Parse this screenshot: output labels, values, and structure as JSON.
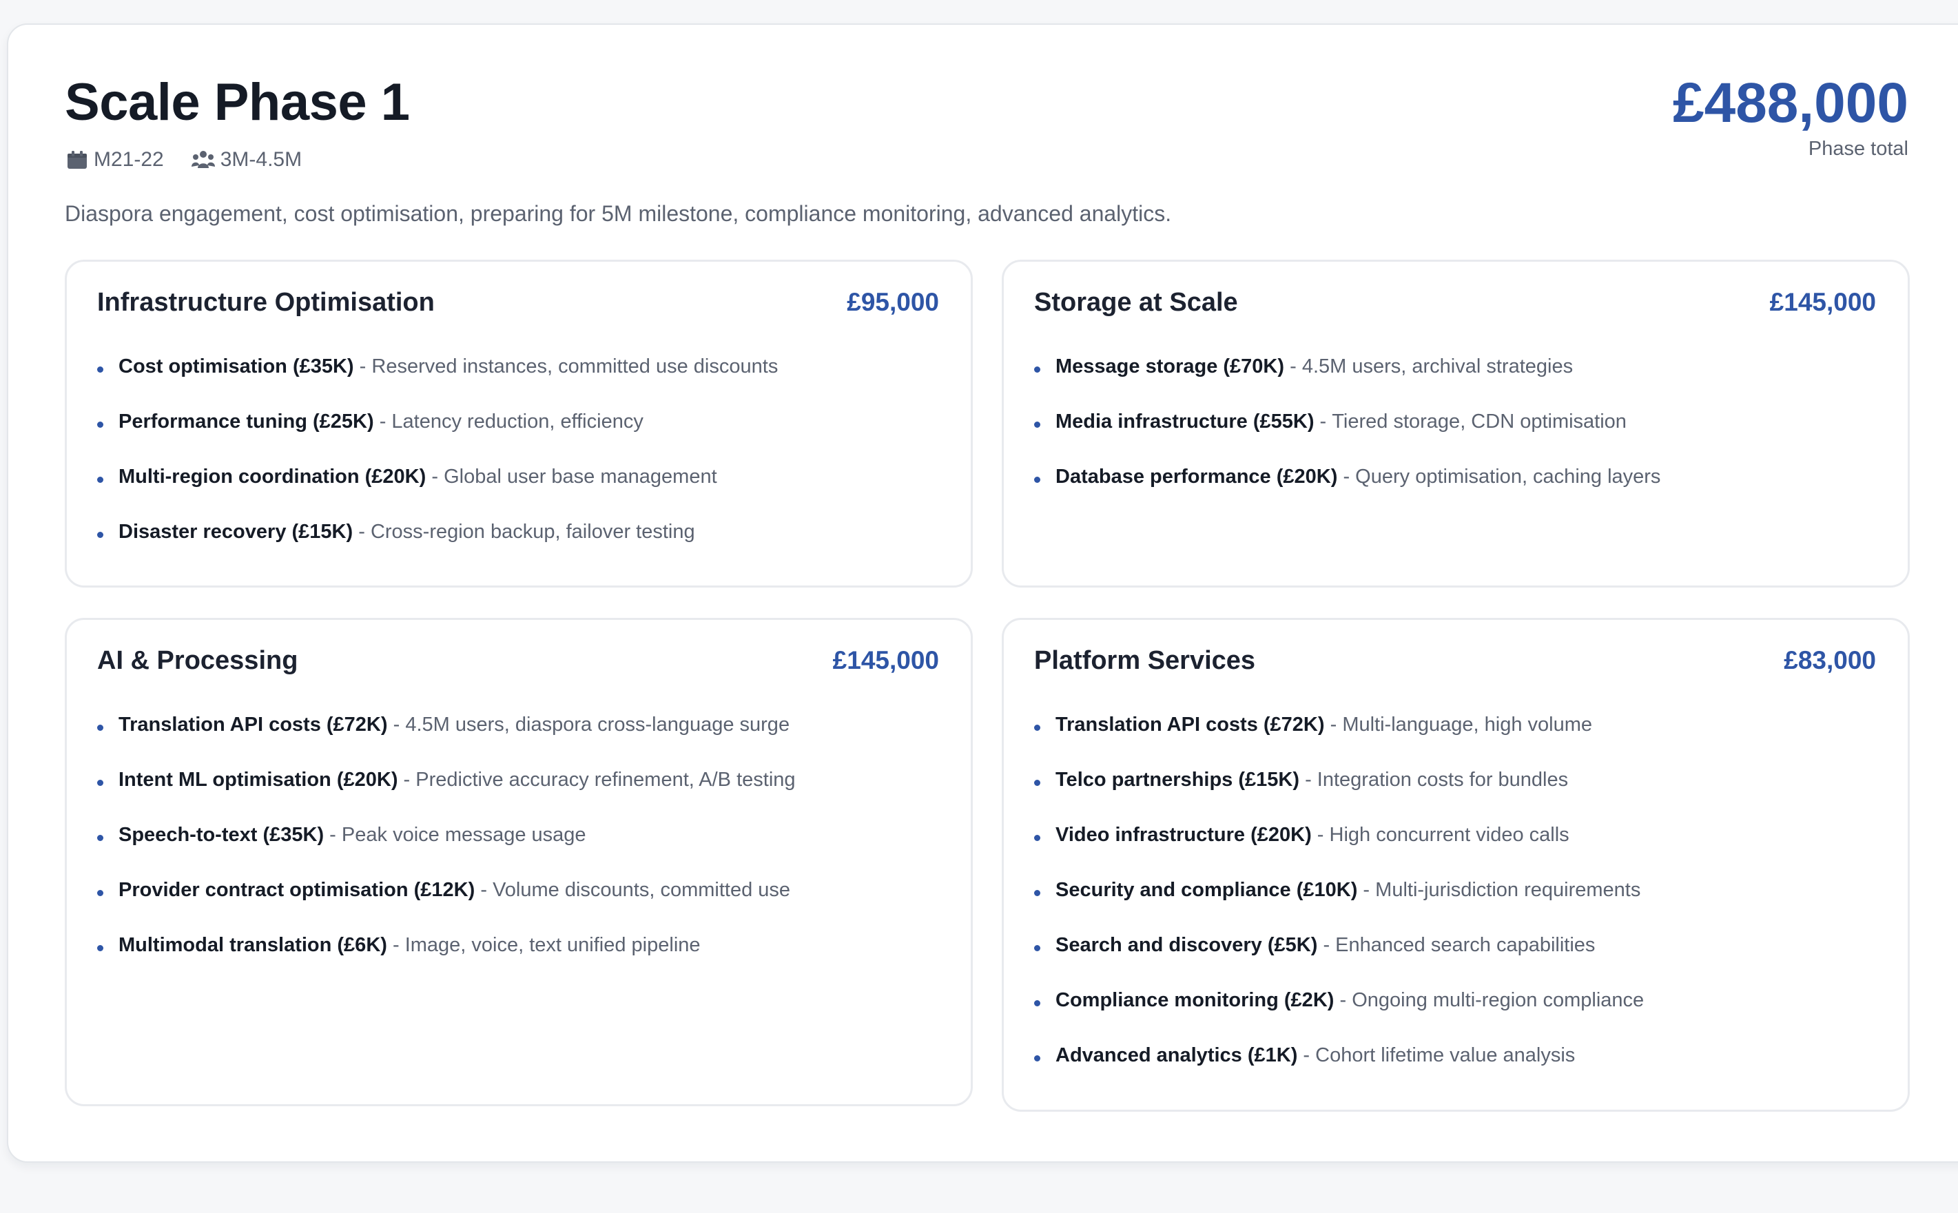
{
  "phase": {
    "title": "Scale Phase 1",
    "months": "M21-22",
    "users": "3M-4.5M",
    "total": "£488,000",
    "total_caption": "Phase total",
    "description": "Diaspora engagement, cost optimisation, preparing for 5M milestone, compliance monitoring, advanced analytics.",
    "icons": {
      "months": "calendar-icon",
      "users": "users-icon"
    },
    "colors": {
      "accent": "#2e55a6",
      "title": "#151b26",
      "muted": "#5b6270"
    }
  },
  "categories": [
    {
      "title": "Infrastructure Optimisation",
      "amount": "£95,000",
      "items": [
        {
          "name": "Cost optimisation (£35K)",
          "detail": "Reserved instances, committed use discounts"
        },
        {
          "name": "Performance tuning (£25K)",
          "detail": "Latency reduction, efficiency"
        },
        {
          "name": "Multi-region coordination (£20K)",
          "detail": "Global user base management"
        },
        {
          "name": "Disaster recovery (£15K)",
          "detail": "Cross-region backup, failover testing"
        }
      ]
    },
    {
      "title": "Storage at Scale",
      "amount": "£145,000",
      "items": [
        {
          "name": "Message storage (£70K)",
          "detail": "4.5M users, archival strategies"
        },
        {
          "name": "Media infrastructure (£55K)",
          "detail": "Tiered storage, CDN optimisation"
        },
        {
          "name": "Database performance (£20K)",
          "detail": "Query optimisation, caching layers"
        }
      ]
    },
    {
      "title": "AI & Processing",
      "amount": "£145,000",
      "items": [
        {
          "name": "Translation API costs (£72K)",
          "detail": "4.5M users, diaspora cross-language surge"
        },
        {
          "name": "Intent ML optimisation (£20K)",
          "detail": "Predictive accuracy refinement, A/B testing"
        },
        {
          "name": "Speech-to-text (£35K)",
          "detail": "Peak voice message usage"
        },
        {
          "name": "Provider contract optimisation (£12K)",
          "detail": "Volume discounts, committed use"
        },
        {
          "name": "Multimodal translation (£6K)",
          "detail": "Image, voice, text unified pipeline"
        }
      ]
    },
    {
      "title": "Platform Services",
      "amount": "£83,000",
      "items": [
        {
          "name": "Translation API costs (£72K)",
          "detail": "Multi-language, high volume"
        },
        {
          "name": "Telco partnerships (£15K)",
          "detail": "Integration costs for bundles"
        },
        {
          "name": "Video infrastructure (£20K)",
          "detail": "High concurrent video calls"
        },
        {
          "name": "Security and compliance (£10K)",
          "detail": "Multi-jurisdiction requirements"
        },
        {
          "name": "Search and discovery (£5K)",
          "detail": "Enhanced search capabilities"
        },
        {
          "name": "Compliance monitoring (£2K)",
          "detail": "Ongoing multi-region compliance"
        },
        {
          "name": "Advanced analytics (£1K)",
          "detail": "Cohort lifetime value analysis"
        }
      ]
    }
  ]
}
